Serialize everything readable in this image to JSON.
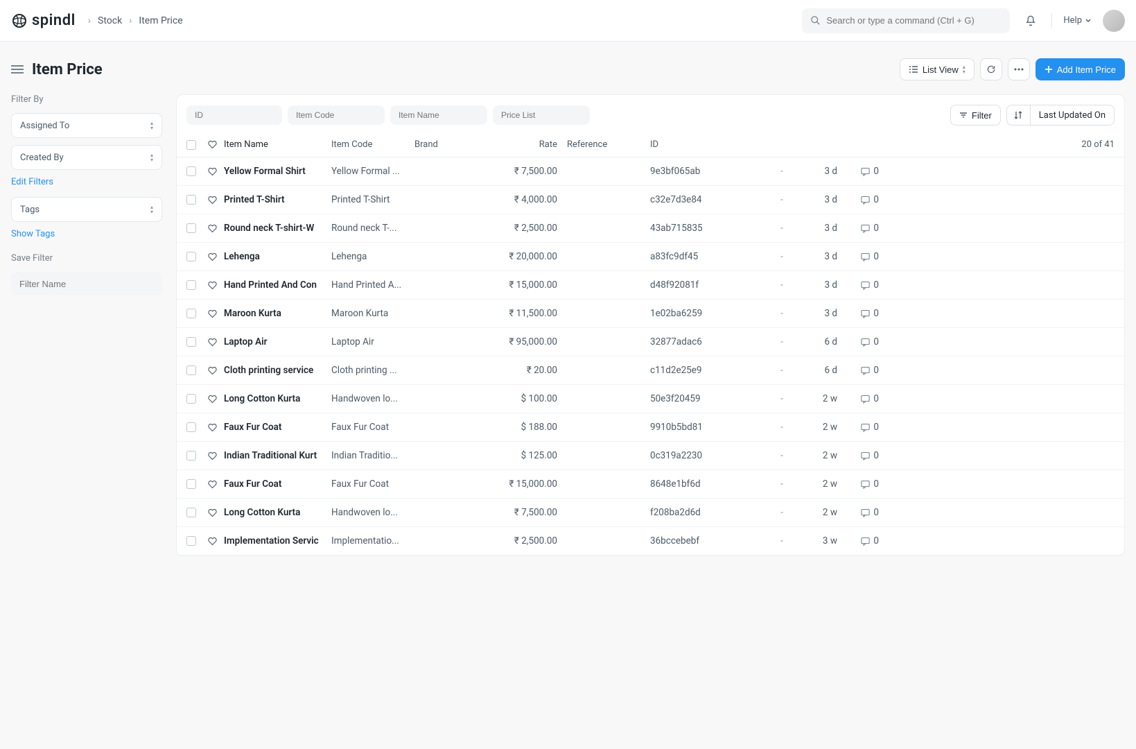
{
  "logo": "spindl",
  "breadcrumb": {
    "parent": "Stock",
    "current": "Item Price"
  },
  "search": {
    "placeholder": "Search or type a command (Ctrl + G)"
  },
  "help": "Help",
  "page_title": "Item Price",
  "view_menu": "List View",
  "add_button": "Add Item Price",
  "sidebar": {
    "filter_by": "Filter By",
    "assigned_to": "Assigned To",
    "created_by": "Created By",
    "edit_filters": "Edit Filters",
    "tags": "Tags",
    "show_tags": "Show Tags",
    "save_filter": "Save Filter",
    "filter_name_placeholder": "Filter Name"
  },
  "toolbar": {
    "id": "ID",
    "item_code": "Item Code",
    "item_name": "Item Name",
    "price_list": "Price List",
    "filter": "Filter",
    "sort": "Last Updated On"
  },
  "columns": {
    "item_name": "Item Name",
    "item_code": "Item Code",
    "brand": "Brand",
    "rate": "Rate",
    "reference": "Reference",
    "id": "ID",
    "count": "20 of 41"
  },
  "rows": [
    {
      "name": "Yellow Formal Shirt",
      "code": "Yellow Formal ...",
      "rate": "₹ 7,500.00",
      "id": "9e3bf065ab",
      "age": "3 d",
      "comments": "0",
      "dash": "-"
    },
    {
      "name": "Printed T-Shirt",
      "code": "Printed T-Shirt",
      "rate": "₹ 4,000.00",
      "id": "c32e7d3e84",
      "age": "3 d",
      "comments": "0",
      "dash": "-"
    },
    {
      "name": "Round neck T-shirt-W",
      "code": "Round neck T-...",
      "rate": "₹ 2,500.00",
      "id": "43ab715835",
      "age": "3 d",
      "comments": "0",
      "dash": "-"
    },
    {
      "name": "Lehenga",
      "code": "Lehenga",
      "rate": "₹ 20,000.00",
      "id": "a83fc9df45",
      "age": "3 d",
      "comments": "0",
      "dash": "-"
    },
    {
      "name": "Hand Printed And Con",
      "code": "Hand Printed A...",
      "rate": "₹ 15,000.00",
      "id": "d48f92081f",
      "age": "3 d",
      "comments": "0",
      "dash": "-"
    },
    {
      "name": "Maroon Kurta",
      "code": "Maroon Kurta",
      "rate": "₹ 11,500.00",
      "id": "1e02ba6259",
      "age": "3 d",
      "comments": "0",
      "dash": "-"
    },
    {
      "name": "Laptop Air",
      "code": "Laptop Air",
      "rate": "₹ 95,000.00",
      "id": "32877adac6",
      "age": "6 d",
      "comments": "0",
      "dash": "-"
    },
    {
      "name": "Cloth printing service",
      "code": "Cloth printing ...",
      "rate": "₹ 20.00",
      "id": "c11d2e25e9",
      "age": "6 d",
      "comments": "0",
      "dash": "-"
    },
    {
      "name": "Long Cotton Kurta",
      "code": "Handwoven lo...",
      "rate": "$ 100.00",
      "id": "50e3f20459",
      "age": "2 w",
      "comments": "0",
      "dash": "-"
    },
    {
      "name": "Faux Fur Coat",
      "code": "Faux Fur Coat",
      "rate": "$ 188.00",
      "id": "9910b5bd81",
      "age": "2 w",
      "comments": "0",
      "dash": "-"
    },
    {
      "name": "Indian Traditional Kurt",
      "code": "Indian Traditio...",
      "rate": "$ 125.00",
      "id": "0c319a2230",
      "age": "2 w",
      "comments": "0",
      "dash": "-"
    },
    {
      "name": "Faux Fur Coat",
      "code": "Faux Fur Coat",
      "rate": "₹ 15,000.00",
      "id": "8648e1bf6d",
      "age": "2 w",
      "comments": "0",
      "dash": "-"
    },
    {
      "name": "Long Cotton Kurta",
      "code": "Handwoven lo...",
      "rate": "₹ 7,500.00",
      "id": "f208ba2d6d",
      "age": "2 w",
      "comments": "0",
      "dash": "-"
    },
    {
      "name": "Implementation Servic",
      "code": "Implementatio...",
      "rate": "₹ 2,500.00",
      "id": "36bccebebf",
      "age": "3 w",
      "comments": "0",
      "dash": "-"
    }
  ]
}
